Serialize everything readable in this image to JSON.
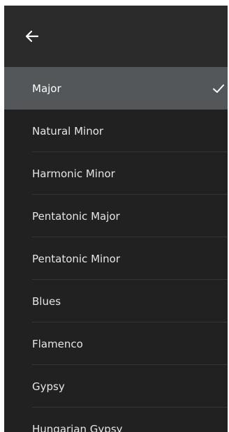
{
  "header": {
    "back_icon": "arrow-left-icon"
  },
  "scales": {
    "selected": "Major",
    "items": [
      {
        "label": "Major"
      },
      {
        "label": "Natural Minor"
      },
      {
        "label": "Harmonic Minor"
      },
      {
        "label": "Pentatonic Major"
      },
      {
        "label": "Pentatonic Minor"
      },
      {
        "label": "Blues"
      },
      {
        "label": "Flamenco"
      },
      {
        "label": "Gypsy"
      },
      {
        "label": "Hungarian Gypsy"
      }
    ]
  },
  "colors": {
    "background": "#212121",
    "header": "#2b2b2b",
    "selected_row": "#545759",
    "text": "#e6e6e6"
  }
}
